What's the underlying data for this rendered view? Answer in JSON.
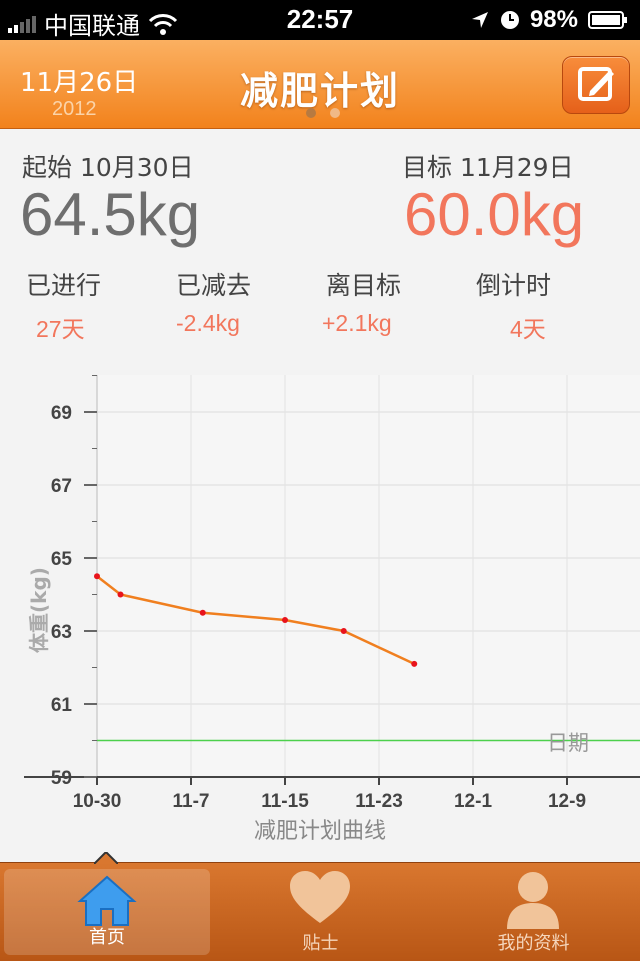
{
  "status": {
    "carrier": "中国联通",
    "time": "22:57",
    "battery": "98%"
  },
  "header": {
    "date": "11月26日",
    "year": "2012",
    "title": "减肥计划",
    "edit_icon": "edit-note-icon"
  },
  "summary": {
    "start_label": "起始",
    "start_date": "10月30日",
    "start_weight": "64.5kg",
    "goal_label": "目标",
    "goal_date": "11月29日",
    "goal_weight": "60.0kg",
    "stats": [
      {
        "label": "已进行",
        "value": "27天"
      },
      {
        "label": "已减去",
        "value": "-2.4kg"
      },
      {
        "label": "离目标",
        "value": "+2.1kg"
      },
      {
        "label": "倒计时",
        "value": "4天"
      }
    ]
  },
  "chart_data": {
    "type": "line",
    "title": "减肥计划曲线",
    "ylabel": "体重(kg)",
    "xlabel": "日期",
    "y_ticks": [
      59,
      61,
      63,
      65,
      67,
      69
    ],
    "ylim": [
      59,
      70
    ],
    "x_ticks": [
      "10-30",
      "11-7",
      "11-15",
      "11-23",
      "12-1",
      "12-9"
    ],
    "x_range_days": [
      0,
      40
    ],
    "series": [
      {
        "values": [
          {
            "x": "10-30",
            "y": 64.5
          },
          {
            "x": "11-1",
            "y": 64.0
          },
          {
            "x": "11-8",
            "y": 63.5
          },
          {
            "x": "11-15",
            "y": 63.3
          },
          {
            "x": "11-20",
            "y": 63.0
          },
          {
            "x": "11-26",
            "y": 62.1
          }
        ]
      }
    ],
    "target_line": 60.0,
    "colors": {
      "line": "#f07f1f",
      "point": "#e8131b",
      "target": "#4cd04c"
    }
  },
  "tabs": [
    {
      "label": "首页",
      "icon": "home-icon"
    },
    {
      "label": "贴士",
      "icon": "heart-icon"
    },
    {
      "label": "我的资料",
      "icon": "user-profile-icon"
    }
  ]
}
